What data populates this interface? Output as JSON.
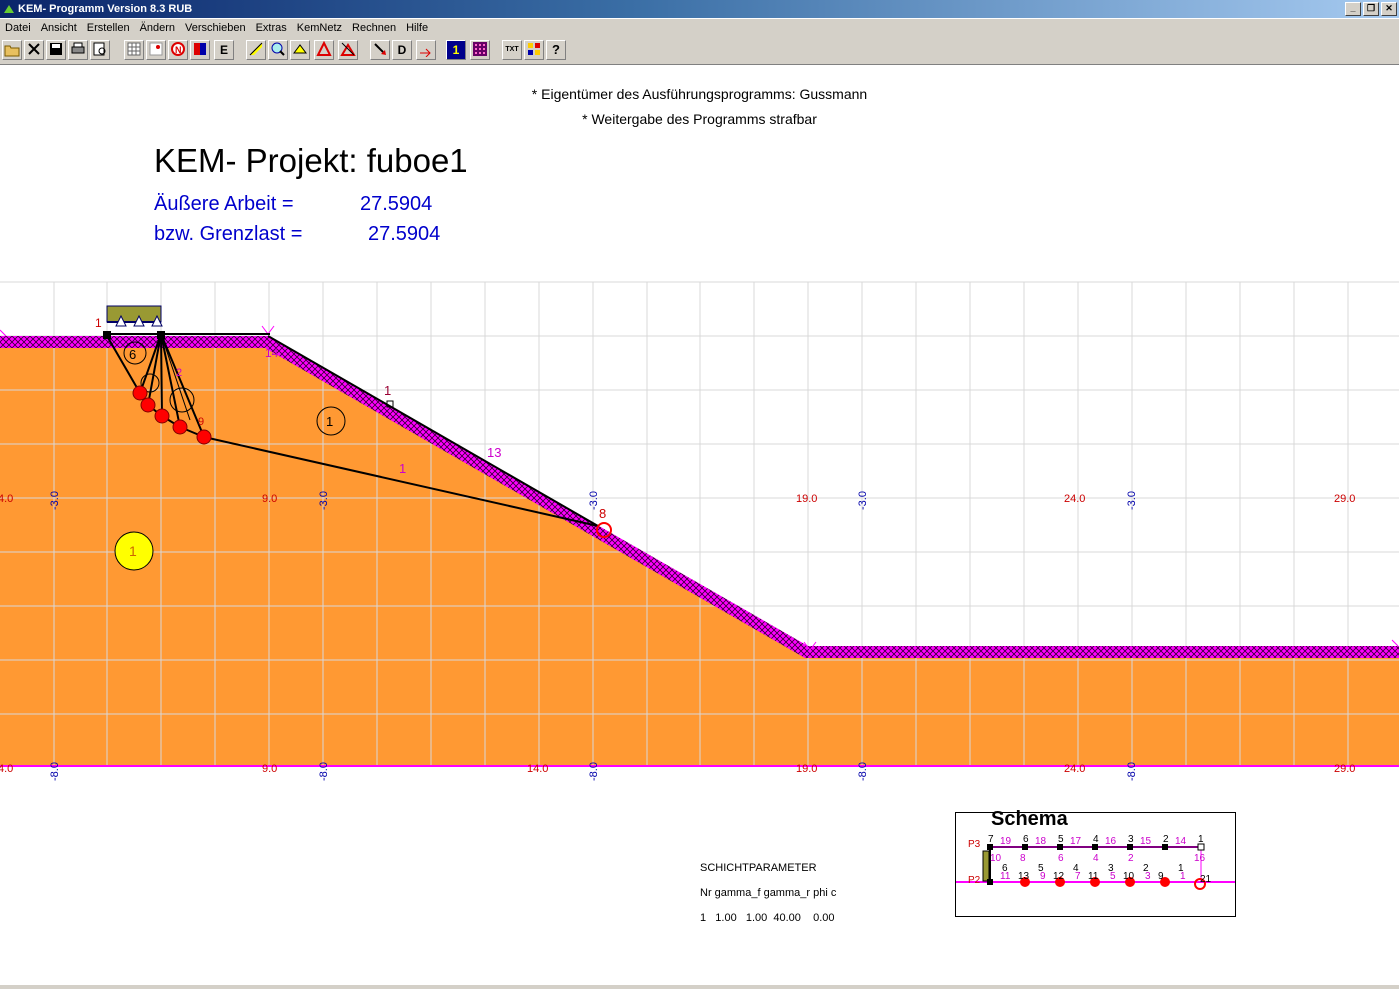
{
  "window": {
    "title": "KEM- Programm Version 8.3 RUB"
  },
  "menu": [
    "Datei",
    "Ansicht",
    "Erstellen",
    "Ändern",
    "Verschieben",
    "Extras",
    "KemNetz",
    "Rechnen",
    "Hilfe"
  ],
  "toolbar": [
    "open-icon",
    "close-file-icon",
    "save-icon",
    "print-icon",
    "print-preview-icon",
    "grid-icon",
    "point-icon",
    "no-icon",
    "color-icon",
    "e-icon",
    "edit-icon",
    "zoom-icon",
    "shift-icon",
    "triangle-icon",
    "triangle-alt-icon",
    "load-icon",
    "d-icon",
    "arrow-icon",
    "one-icon",
    "matrix-icon",
    "text-icon",
    "layout-icon",
    "help-icon"
  ],
  "toolbar_labels": {
    "e": "E",
    "d": "D",
    "one": "1",
    "text": "TXT"
  },
  "notice": {
    "line1": "* Eigentümer des Ausführungsprogramms: Gussmann",
    "line2": "* Weitergabe des Programms strafbar"
  },
  "project": {
    "title": "KEM- Projekt: fuboe1",
    "arbeit_label": "Äußere Arbeit =",
    "arbeit_value": "27.5904",
    "grenz_label": "bzw. Grenzlast =",
    "grenz_value": "27.5904"
  },
  "axis": {
    "upper_red": [
      "4.0",
      "9.0",
      "19.0",
      "24.0",
      "29.0"
    ],
    "upper_blue": [
      "-3.0",
      "-3.0",
      "-3.0",
      "-3.0",
      "-3.0"
    ],
    "lower_red": [
      "4.0",
      "9.0",
      "14.0",
      "19.0",
      "24.0",
      "29.0"
    ],
    "lower_blue": [
      "-8.0",
      "-8.0",
      "-8.0",
      "-8.0",
      "-8.0"
    ]
  },
  "mechanism": {
    "labels": {
      "body_6": "6",
      "body_1": "1",
      "layer_1": "1",
      "line_1": "1",
      "slope_node": "13",
      "slip_label": "1",
      "end_node": "8",
      "mid_node": "14",
      "node_2": "2",
      "node_9": "9"
    }
  },
  "colors": {
    "soil": "#ff9933",
    "surface": "#ff00ff",
    "mechanism": "#000000",
    "node": "#ff0000",
    "axis_red": "#cc0000",
    "axis_blue": "#0000aa"
  },
  "schicht": {
    "title": "SCHICHTPARAMETER",
    "header": "Nr gamma_f gamma_r phi c",
    "row": "1   1.00   1.00  40.00    0.00"
  },
  "schema": {
    "title": "Schema",
    "p3": "P3",
    "p2": "P2",
    "top_black": [
      "7",
      "6",
      "5",
      "4",
      "3",
      "2",
      "1"
    ],
    "top_magenta": [
      "19",
      "18",
      "17",
      "16",
      "15",
      "14"
    ],
    "mid_magenta": [
      "10",
      "8",
      "6",
      "4",
      "2",
      "16"
    ],
    "mid_black": [
      "6",
      "5",
      "4",
      "3",
      "2",
      "1"
    ],
    "bot_magenta": [
      "11",
      "9",
      "7",
      "5",
      "3",
      "1"
    ],
    "bot_black": [
      "13",
      "12",
      "11",
      "10",
      "9",
      "21"
    ]
  }
}
